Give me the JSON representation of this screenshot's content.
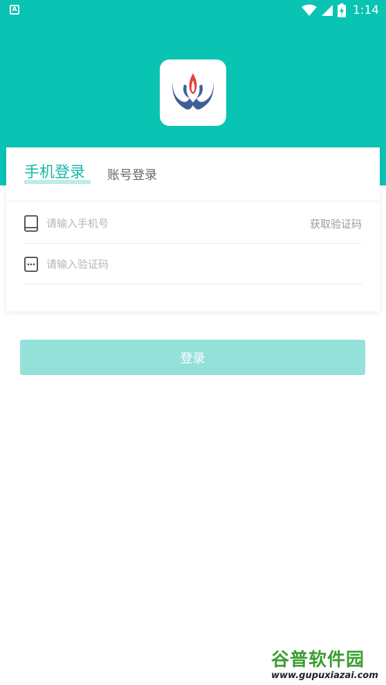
{
  "status_bar": {
    "app_icon_letter": "A",
    "time": "1:14"
  },
  "colors": {
    "brand": "#09c3b3",
    "active_tab": "#16b8a8",
    "login_button": "#94e1d9"
  },
  "tabs": {
    "phone_login": "手机登录",
    "account_login": "账号登录"
  },
  "phone_field": {
    "placeholder": "请输入手机号",
    "value": "",
    "get_code_label": "获取验证码"
  },
  "code_field": {
    "placeholder": "请输入验证码",
    "value": ""
  },
  "login_button_label": "登录",
  "watermark": {
    "title": "谷普软件园",
    "url": "www.gupuxiazai.com"
  }
}
